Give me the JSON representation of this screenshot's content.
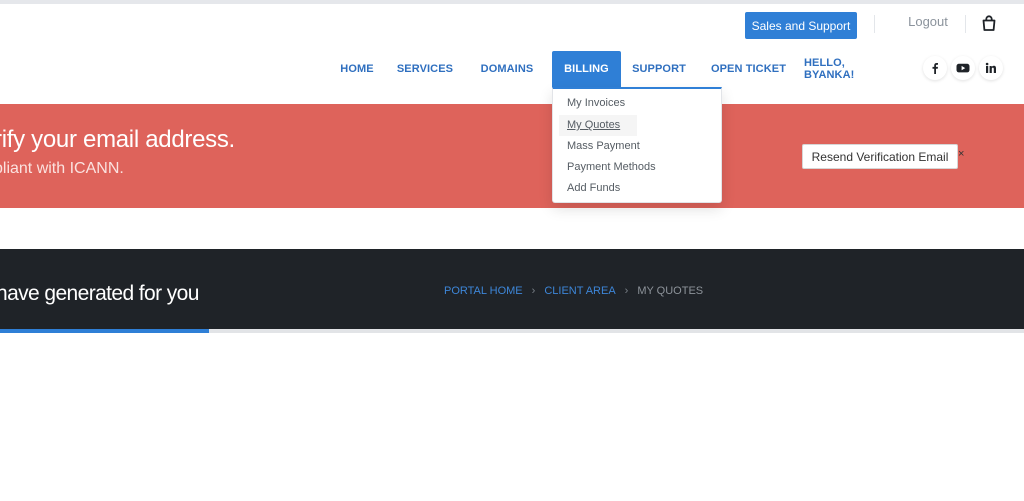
{
  "header": {
    "sales_button": "Sales and Support",
    "logout": "Logout",
    "cart_icon": "shopping-bag-icon"
  },
  "nav": {
    "items": [
      "HOME",
      "SERVICES",
      "DOMAINS",
      "BILLING",
      "SUPPORT",
      "OPEN TICKET",
      "HELLO, BYANKA!"
    ],
    "active": "BILLING",
    "social_icons": [
      "facebook-icon",
      "youtube-icon",
      "linkedin-icon"
    ]
  },
  "billing_menu": {
    "items": [
      "My Invoices",
      "My Quotes",
      "Mass Payment",
      "Payment Methods",
      "Add Funds"
    ],
    "hovered": "My Quotes"
  },
  "alert": {
    "title": "rify your email address.",
    "subtitle": "bliant with ICANN.",
    "button": "Resend Verification Email",
    "close": "×",
    "color": "#de635b"
  },
  "page_header": {
    "title": "have generated for you",
    "breadcrumb": [
      "PORTAL HOME",
      "CLIENT AREA",
      "MY QUOTES"
    ],
    "separator": "›"
  },
  "colors": {
    "accent": "#2f7fd6",
    "dark": "#1f2328"
  }
}
